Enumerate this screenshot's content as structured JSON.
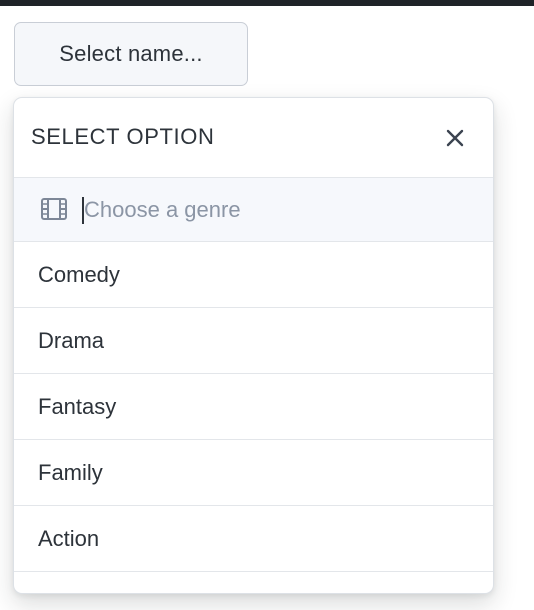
{
  "trigger": {
    "label": "Select name..."
  },
  "dropdown": {
    "title": "SELECT OPTION",
    "close_icon": "close-icon",
    "search": {
      "icon": "film-icon",
      "value": "",
      "placeholder": "Choose a genre"
    },
    "options": [
      {
        "label": "Comedy"
      },
      {
        "label": "Drama"
      },
      {
        "label": "Fantasy"
      },
      {
        "label": "Family"
      },
      {
        "label": "Action"
      },
      {
        "label": ""
      }
    ]
  },
  "colors": {
    "text": "#2d333a",
    "placeholder": "#8b95a5",
    "search_background": "#f6f8fc",
    "border": "#e3e6ea",
    "button_background": "#f5f7fa"
  }
}
